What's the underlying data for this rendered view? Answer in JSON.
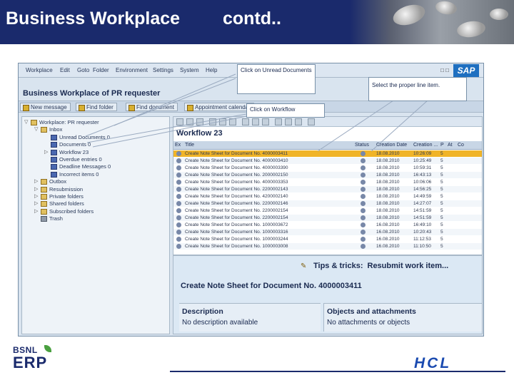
{
  "slide": {
    "title": "Business Workplace",
    "title_suffix": "contd.."
  },
  "callouts": {
    "unread": "Click on Unread Documents",
    "workflow": "Click on Workflow",
    "line_item": "Select the proper line item."
  },
  "sap": {
    "logo": "SAP",
    "window_controls": "□ □",
    "menu": [
      "Workplace",
      "Edit",
      "Goto",
      "Folder",
      "Environment",
      "Settings",
      "System",
      "Help"
    ],
    "page_title": "Business Workplace of PR requester",
    "toolbar": [
      "New message",
      "Find folder",
      "Find document",
      "Appointment calendar"
    ],
    "tree": [
      {
        "label": "Workplace: PR requester",
        "indent": 0,
        "icon": "folder",
        "twisty": "▽"
      },
      {
        "label": "Inbox",
        "indent": 1,
        "icon": "folder",
        "twisty": "▽"
      },
      {
        "label": "Unread Documents 0",
        "indent": 2,
        "icon": "doc",
        "twisty": ""
      },
      {
        "label": "Documents 0",
        "indent": 2,
        "icon": "doc",
        "twisty": ""
      },
      {
        "label": "Workflow 23",
        "indent": 2,
        "icon": "doc",
        "twisty": "▷"
      },
      {
        "label": "Overdue entries 0",
        "indent": 2,
        "icon": "doc",
        "twisty": ""
      },
      {
        "label": "Deadline Messages 0",
        "indent": 2,
        "icon": "doc",
        "twisty": ""
      },
      {
        "label": "Incorrect items 0",
        "indent": 2,
        "icon": "doc",
        "twisty": ""
      },
      {
        "label": "Outbox",
        "indent": 1,
        "icon": "folder",
        "twisty": "▷"
      },
      {
        "label": "Resubmission",
        "indent": 1,
        "icon": "folder",
        "twisty": "▷"
      },
      {
        "label": "Private folders",
        "indent": 1,
        "icon": "folder",
        "twisty": "▷"
      },
      {
        "label": "Shared folders",
        "indent": 1,
        "icon": "folder",
        "twisty": "▷"
      },
      {
        "label": "Subscribed folders",
        "indent": 1,
        "icon": "folder",
        "twisty": "▷"
      },
      {
        "label": "Trash",
        "indent": 1,
        "icon": "trash",
        "twisty": ""
      }
    ],
    "workflow": {
      "title": "Workflow 23",
      "columns": [
        "Ex",
        "Title",
        "Status",
        "Creation Date",
        "Creation ...",
        "P",
        "At",
        "Co"
      ],
      "rows": [
        {
          "title": "Create Note Sheet for Document No. 4000003411",
          "date": "18.08.2010",
          "time": "10:26:09",
          "p": "5"
        },
        {
          "title": "Create Note Sheet for Document No. 4000003410",
          "date": "18.08.2010",
          "time": "10:25:49",
          "p": "5"
        },
        {
          "title": "Create Note Sheet for Document No. 4000003390",
          "date": "18.08.2010",
          "time": "10:59:31",
          "p": "5"
        },
        {
          "title": "Create Note Sheet for Document No. 2000002150",
          "date": "18.08.2010",
          "time": "16:43:13",
          "p": "5"
        },
        {
          "title": "Create Note Sheet for Document No. 4000003353",
          "date": "18.08.2010",
          "time": "10:06:06",
          "p": "5"
        },
        {
          "title": "Create Note Sheet for Document No. 2200002143",
          "date": "18.08.2010",
          "time": "14:56:25",
          "p": "5"
        },
        {
          "title": "Create Note Sheet for Document No. 4200002140",
          "date": "18.08.2010",
          "time": "14:49:59",
          "p": "5"
        },
        {
          "title": "Create Note Sheet for Document No. 2200002146",
          "date": "18.08.2010",
          "time": "14:27:07",
          "p": "5"
        },
        {
          "title": "Create Note Sheet for Document No. 2200002154",
          "date": "18.08.2010",
          "time": "14:51:59",
          "p": "5"
        },
        {
          "title": "Create Note Sheet for Document No. 2200002154",
          "date": "18.08.2010",
          "time": "14:51:59",
          "p": "5"
        },
        {
          "title": "Create Note Sheet for Document No. 1000003672",
          "date": "16.08.2010",
          "time": "16:49:10",
          "p": "5"
        },
        {
          "title": "Create Note Sheet for Document No. 1000003316",
          "date": "16.08.2010",
          "time": "10:20:43",
          "p": "5"
        },
        {
          "title": "Create Note Sheet for Document No. 1000003244",
          "date": "16.08.2010",
          "time": "11:12:53",
          "p": "5"
        },
        {
          "title": "Create Note Sheet for Document No. 1000003008",
          "date": "16.08.2010",
          "time": "11:10:50",
          "p": "5"
        }
      ],
      "selected_index": 0
    },
    "preview": {
      "tips_label": "Tips & tricks:",
      "tips_value": "Resubmit work item...",
      "heading": "Create Note Sheet for Document No. 4000003411",
      "description_label": "Description",
      "description_value": "No description available",
      "objects_label": "Objects and attachments",
      "objects_value": "No attachments or objects"
    }
  },
  "footer": {
    "bsnl_top": "BSNL",
    "bsnl_erp": "ERP",
    "hcl": "HCL"
  },
  "colors": {
    "header": "#1a2a6c",
    "selected_row": "#f0b428",
    "sap_blue": "#1e6fc0"
  }
}
